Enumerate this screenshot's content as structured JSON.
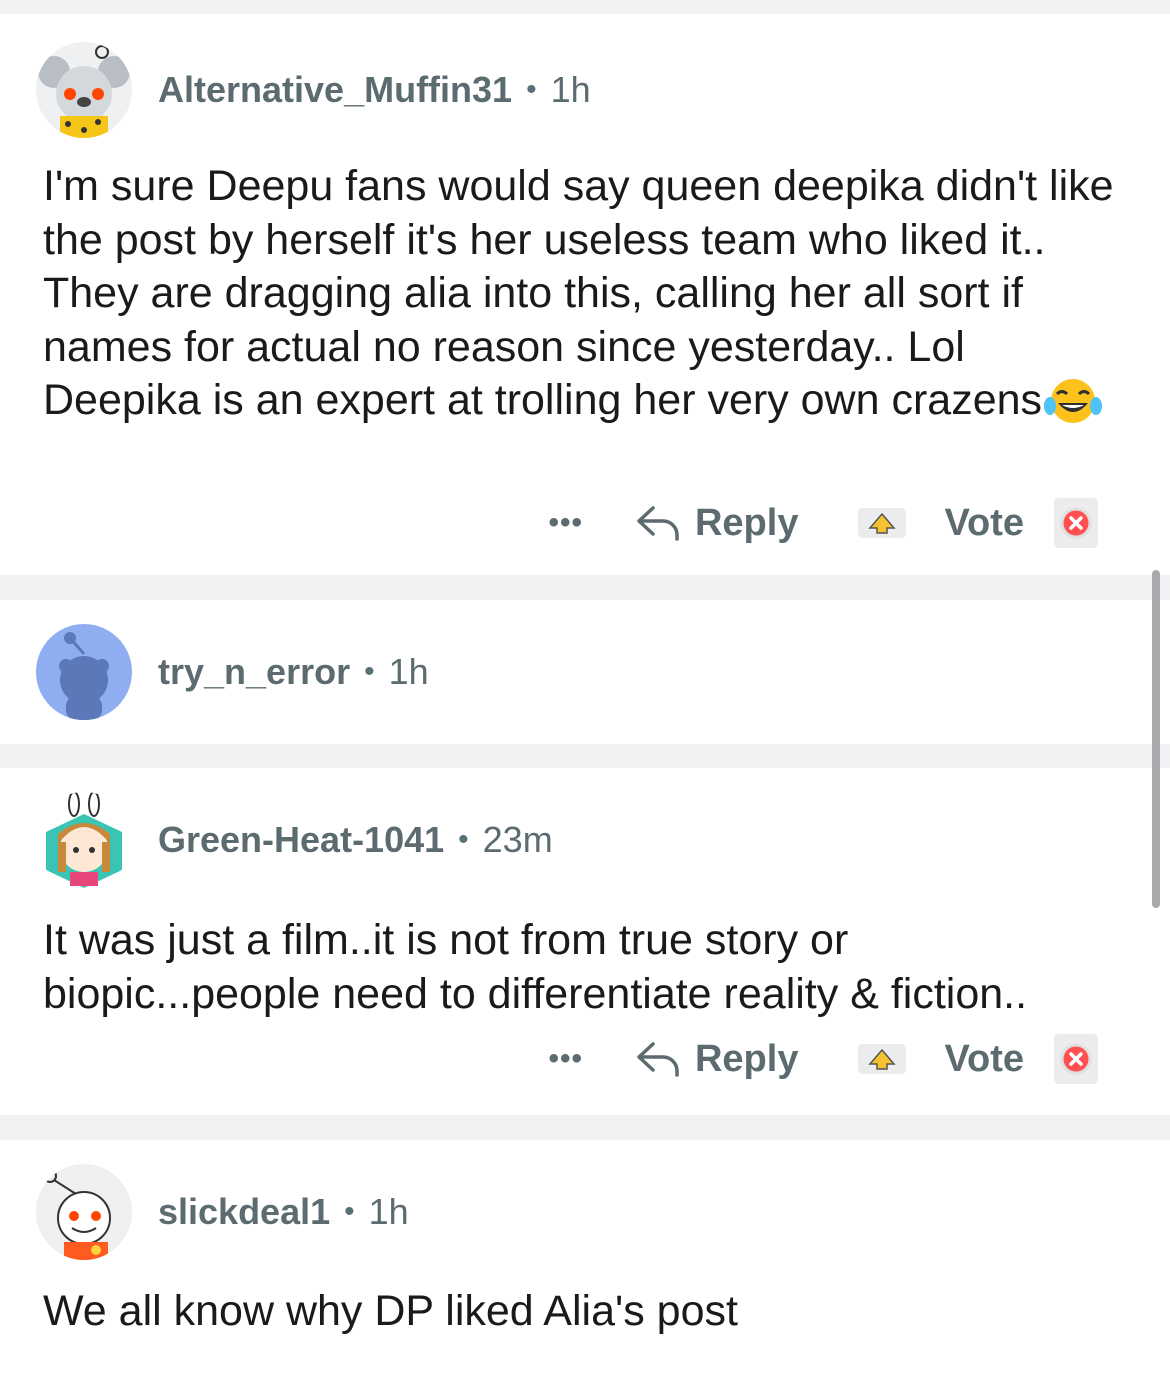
{
  "comments": [
    {
      "username": "Alternative_Muffin31",
      "separator": "•",
      "time": "1h",
      "body": "I'm sure Deepu fans would say queen deepika didn't like the post by herself it's her useless team who liked it.. They are dragging alia into this, calling her all sort if names for actual no reason since yesterday.. Lol Deepika is an expert at trolling her very own crazens",
      "emoji": "face-with-tears-of-joy",
      "actions": {
        "more": "•••",
        "reply": "Reply",
        "vote": "Vote"
      }
    },
    {
      "username": "try_n_error",
      "separator": "•",
      "time": "1h"
    },
    {
      "username": "Green-Heat-1041",
      "separator": "•",
      "time": "23m",
      "body": "It was just a film..it is not from true story or biopic...people need to differentiate reality & fiction..",
      "actions": {
        "more": "•••",
        "reply": "Reply",
        "vote": "Vote"
      }
    },
    {
      "username": "slickdeal1",
      "separator": "•",
      "time": "1h",
      "body": "We all know why DP liked Alia's post"
    }
  ],
  "icons": {
    "reply": "reply-arrow-icon",
    "upvote": "upvote-icon",
    "downvote": "downvote-icon"
  },
  "colors": {
    "background": "#f2f2f4",
    "card": "#ffffff",
    "meta_text": "#5c6b70",
    "downvote_accent": "#ff4f4f"
  }
}
